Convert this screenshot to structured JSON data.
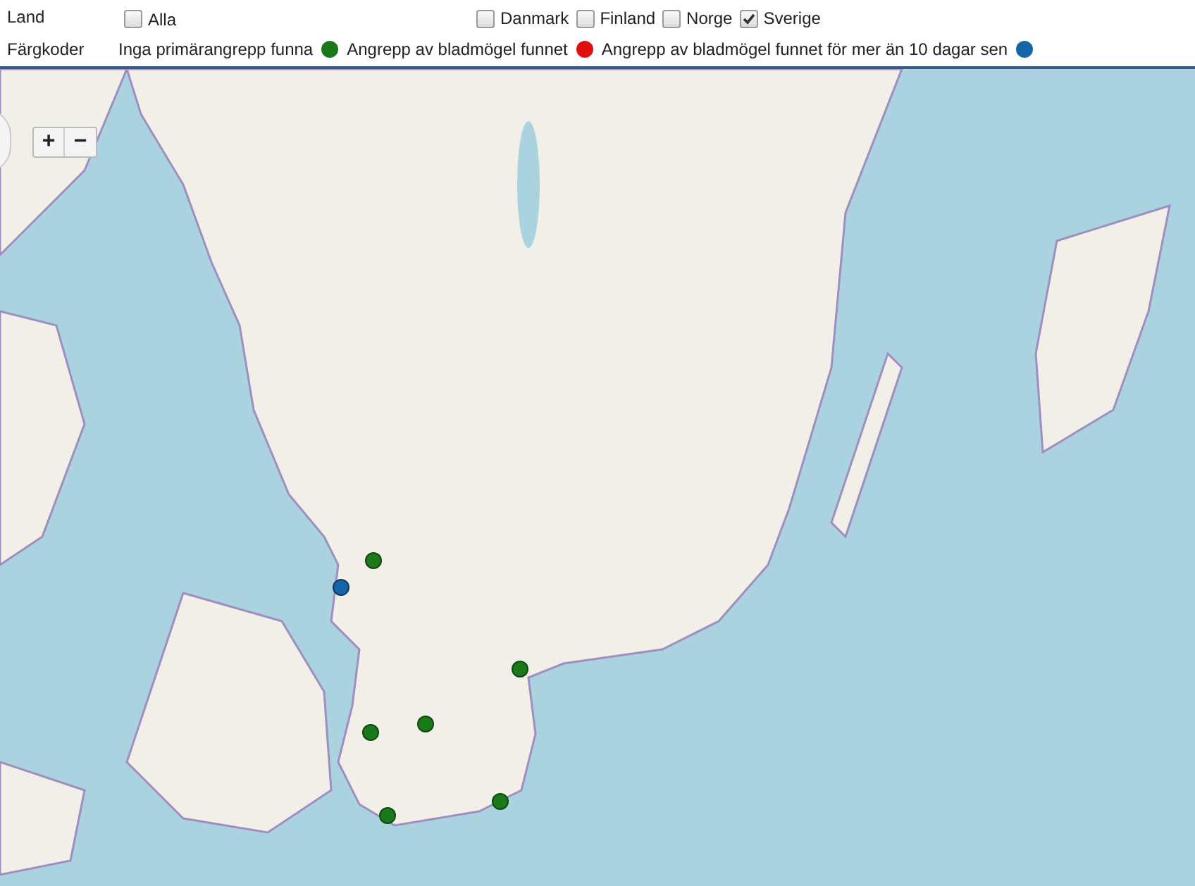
{
  "filters": {
    "label": "Land",
    "options": [
      {
        "label": "Alla",
        "checked": false
      },
      {
        "label": "Danmark",
        "checked": false
      },
      {
        "label": "Finland",
        "checked": false
      },
      {
        "label": "Norge",
        "checked": false
      },
      {
        "label": "Sverige",
        "checked": true
      }
    ]
  },
  "legend": {
    "label": "Färgkoder",
    "items": [
      {
        "label": "Inga primärangrepp funna",
        "color": "#1a7a1a"
      },
      {
        "label": "Angrepp av bladmögel funnet",
        "color": "#e01010"
      },
      {
        "label": "Angrepp av bladmögel funnet för mer än 10 dagar sen",
        "color": "#1565a8"
      }
    ]
  },
  "map": {
    "zoom_in": "+",
    "zoom_out": "−",
    "markers": [
      {
        "color": "#1a7a1a"
      },
      {
        "color": "#1565a8"
      },
      {
        "color": "#1a7a1a"
      },
      {
        "color": "#1a7a1a"
      },
      {
        "color": "#1a7a1a"
      },
      {
        "color": "#1a7a1a"
      },
      {
        "color": "#1a7a1a"
      }
    ]
  }
}
